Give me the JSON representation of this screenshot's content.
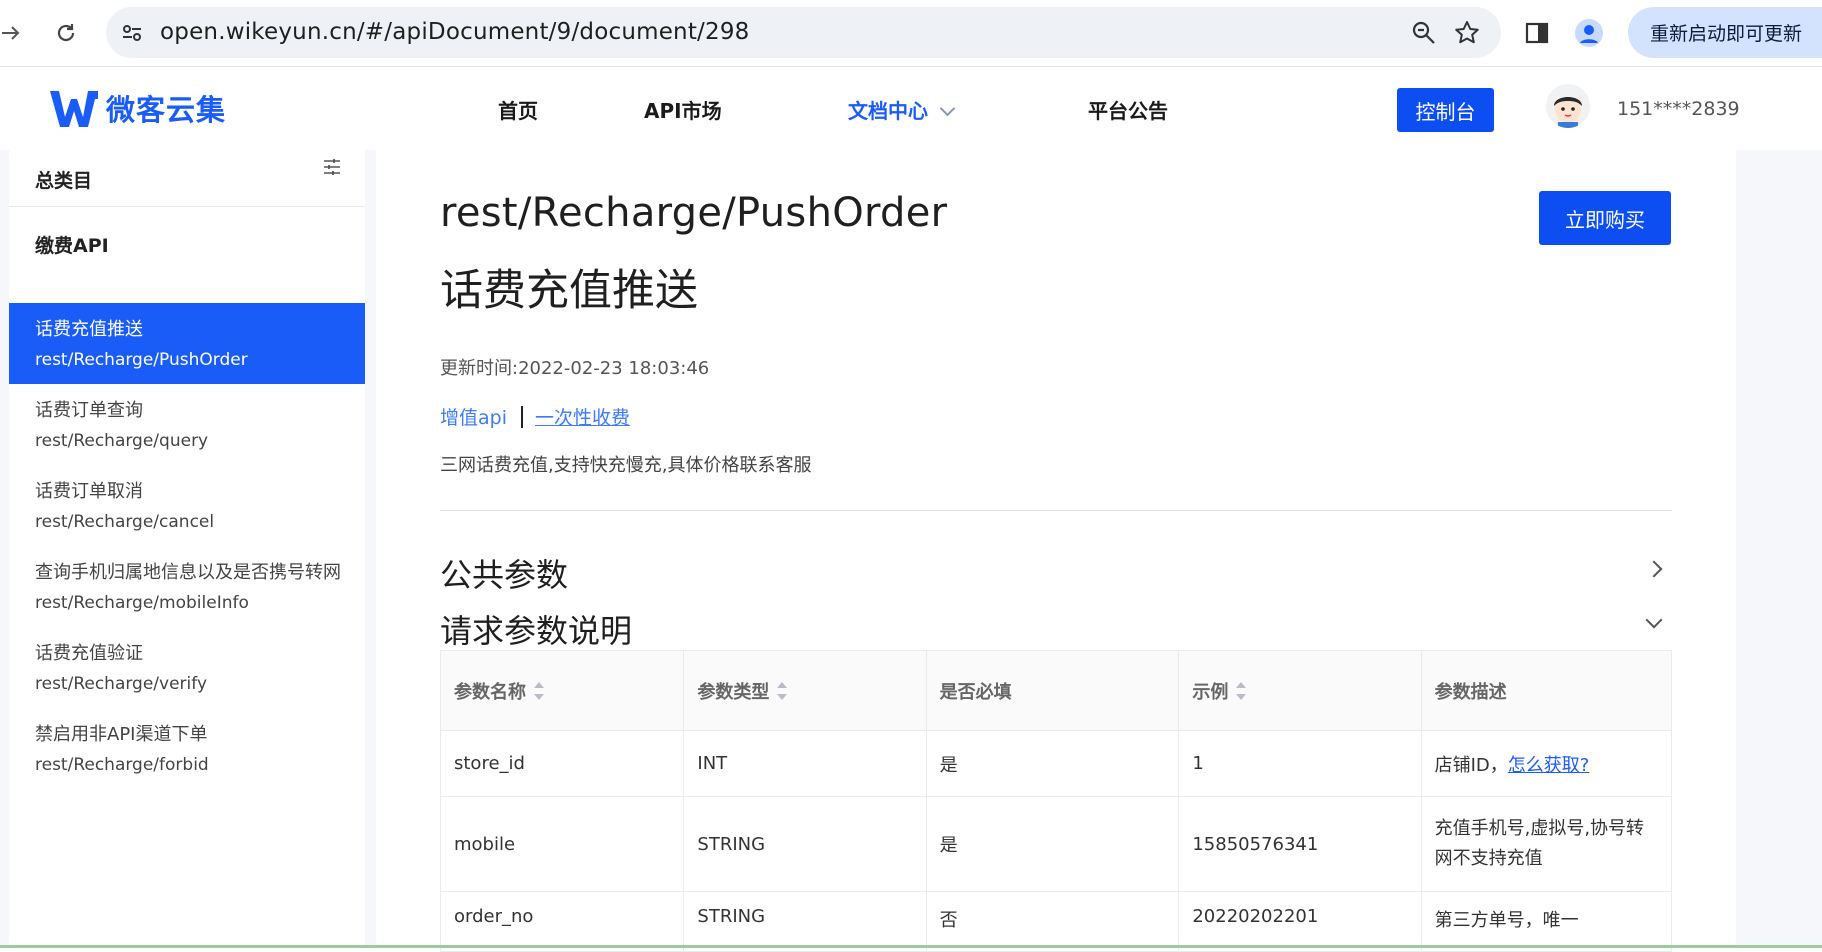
{
  "browser": {
    "url": "open.wikeyun.cn/#/apiDocument/9/document/298",
    "update_label": "重新启动即可更新"
  },
  "site": {
    "logo_text": "微客云集",
    "menu": [
      "首页",
      "API市场",
      "文档中心",
      "平台公告"
    ],
    "console_label": "控制台",
    "user_phone": "151****2839"
  },
  "sidebar": {
    "header": "总类目",
    "category": "缴费API",
    "items": [
      {
        "title": "话费充值推送",
        "path": "rest/Recharge/PushOrder",
        "active": true
      },
      {
        "title": "话费订单查询",
        "path": "rest/Recharge/query",
        "active": false
      },
      {
        "title": "话费订单取消",
        "path": "rest/Recharge/cancel",
        "active": false
      },
      {
        "title": "查询手机归属地信息以及是否携号转网",
        "path": "rest/Recharge/mobileInfo",
        "active": false
      },
      {
        "title": "话费充值验证",
        "path": "rest/Recharge/verify",
        "active": false
      },
      {
        "title": "禁启用非API渠道下单",
        "path": "rest/Recharge/forbid",
        "active": false
      }
    ]
  },
  "doc": {
    "api_path": "rest/Recharge/PushOrder",
    "buy_label": "立即购买",
    "title": "话费充值推送",
    "update_time": "更新时间:2022-02-23 18:03:46",
    "tag1": "增值api",
    "tag2": "一次性收费",
    "description": "三网话费充值,支持快充慢充,具体价格联系客服",
    "section_public": "公共参数",
    "section_request": "请求参数说明",
    "table": {
      "headers": [
        "参数名称",
        "参数类型",
        "是否必填",
        "示例",
        "参数描述"
      ],
      "rows": [
        {
          "name": "store_id",
          "type": "INT",
          "required": "是",
          "example": "1",
          "desc": "店铺ID，",
          "desc_link": "怎么获取?"
        },
        {
          "name": "mobile",
          "type": "STRING",
          "required": "是",
          "example": "15850576341",
          "desc": "充值手机号,虚拟号,协号转网不支持充值",
          "desc_link": ""
        },
        {
          "name": "order_no",
          "type": "STRING",
          "required": "否",
          "example": "20220202201",
          "desc": "第三方单号，唯一",
          "desc_link": ""
        }
      ]
    }
  },
  "colors": {
    "accent": "#1a5cf7",
    "button": "#0d4ef2",
    "link": "#3d7cf5"
  }
}
